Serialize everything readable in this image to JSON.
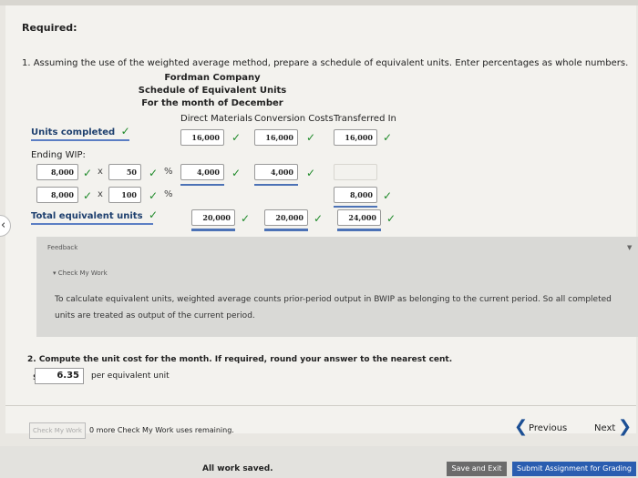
{
  "header": {
    "required": "Required:"
  },
  "q1": {
    "prompt": "1. Assuming the use of the weighted average method, prepare a schedule of equivalent units. Enter percentages as whole numbers.",
    "company": "Fordman Company",
    "schedule_title": "Schedule of Equivalent Units",
    "period": "For the month of December",
    "columns": [
      "Direct Materials",
      "Conversion Costs",
      "Transferred In"
    ],
    "units_completed": {
      "label": "Units completed",
      "values": [
        "16,000",
        "16,000",
        "16,000"
      ]
    },
    "ending_wip": {
      "label": "Ending WIP:",
      "rows": [
        {
          "units": "8,000",
          "mult": "x",
          "percent": "50",
          "pct_sign": "%",
          "dm": "4,000",
          "cc": "4,000",
          "ti": ""
        },
        {
          "units": "8,000",
          "mult": "x",
          "percent": "100",
          "pct_sign": "%",
          "dm": "",
          "cc": "",
          "ti": "8,000"
        }
      ]
    },
    "total": {
      "label": "Total equivalent units",
      "values": [
        "20,000",
        "20,000",
        "24,000"
      ]
    }
  },
  "feedback": {
    "title": "Feedback",
    "check_label": "Check My Work",
    "text": "To calculate equivalent units, weighted average counts prior-period output in BWIP as belonging to the current period. So all completed units are treated as output of the current period."
  },
  "q2": {
    "prompt": "2. Compute the unit cost for the month. If required, round your answer to the nearest cent.",
    "currency": "$",
    "value": "6.35",
    "unit": "per equivalent unit"
  },
  "footer": {
    "check_button": "Check My Work",
    "remaining": "0 more Check My Work uses remaining.",
    "previous": "Previous",
    "next": "Next",
    "saved": "All work saved.",
    "save_exit": "Save and Exit",
    "submit": "Submit Assignment for Grading"
  },
  "icons": {
    "check": "check-icon",
    "chevron_left": "chevron-left-icon",
    "chevron_right": "chevron-right-icon"
  },
  "colors": {
    "check": "#1f8a2a",
    "accent": "#2a5db0",
    "label": "#1d3f6e"
  }
}
